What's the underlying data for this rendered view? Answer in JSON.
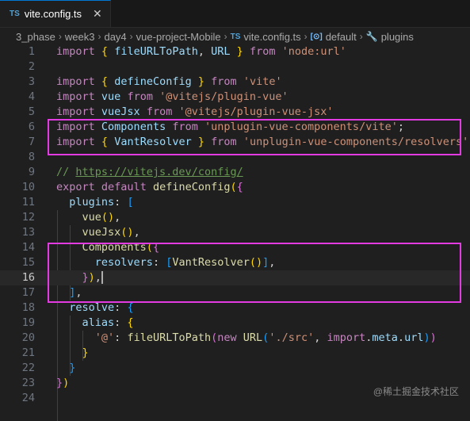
{
  "tab": {
    "badge": "TS",
    "filename": "vite.config.ts",
    "close": "✕"
  },
  "breadcrumb": [
    {
      "label": "3_phase"
    },
    {
      "label": "week3"
    },
    {
      "label": "day4"
    },
    {
      "label": "vue-project-Mobile"
    },
    {
      "icon": "TS",
      "label": "vite.config.ts"
    },
    {
      "icon": "[⊙]",
      "label": "default"
    },
    {
      "icon": "🔧",
      "label": "plugins"
    }
  ],
  "current_line": 16,
  "code_lines": [
    [
      [
        "k",
        "import"
      ],
      [
        "p",
        " "
      ],
      [
        "b1",
        "{"
      ],
      [
        "p",
        " "
      ],
      [
        "v",
        "fileURLToPath"
      ],
      [
        "p",
        ", "
      ],
      [
        "v",
        "URL"
      ],
      [
        "p",
        " "
      ],
      [
        "b1",
        "}"
      ],
      [
        "p",
        " "
      ],
      [
        "k",
        "from"
      ],
      [
        "p",
        " "
      ],
      [
        "s",
        "'node:url'"
      ]
    ],
    [],
    [
      [
        "k",
        "import"
      ],
      [
        "p",
        " "
      ],
      [
        "b1",
        "{"
      ],
      [
        "p",
        " "
      ],
      [
        "v",
        "defineConfig"
      ],
      [
        "p",
        " "
      ],
      [
        "b1",
        "}"
      ],
      [
        "p",
        " "
      ],
      [
        "k",
        "from"
      ],
      [
        "p",
        " "
      ],
      [
        "s",
        "'vite'"
      ]
    ],
    [
      [
        "k",
        "import"
      ],
      [
        "p",
        " "
      ],
      [
        "v",
        "vue"
      ],
      [
        "p",
        " "
      ],
      [
        "k",
        "from"
      ],
      [
        "p",
        " "
      ],
      [
        "s",
        "'@vitejs/plugin-vue'"
      ]
    ],
    [
      [
        "k",
        "import"
      ],
      [
        "p",
        " "
      ],
      [
        "v",
        "vueJsx"
      ],
      [
        "p",
        " "
      ],
      [
        "k",
        "from"
      ],
      [
        "p",
        " "
      ],
      [
        "s",
        "'@vitejs/plugin-vue-jsx'"
      ]
    ],
    [
      [
        "k",
        "import"
      ],
      [
        "p",
        " "
      ],
      [
        "v",
        "Components"
      ],
      [
        "p",
        " "
      ],
      [
        "k",
        "from"
      ],
      [
        "p",
        " "
      ],
      [
        "s",
        "'unplugin-vue-components/vite'"
      ],
      [
        "p",
        ";"
      ]
    ],
    [
      [
        "k",
        "import"
      ],
      [
        "p",
        " "
      ],
      [
        "b1",
        "{"
      ],
      [
        "p",
        " "
      ],
      [
        "v",
        "VantResolver"
      ],
      [
        "p",
        " "
      ],
      [
        "b1",
        "}"
      ],
      [
        "p",
        " "
      ],
      [
        "k",
        "from"
      ],
      [
        "p",
        " "
      ],
      [
        "s",
        "'unplugin-vue-components/resolvers'"
      ],
      [
        "p",
        ";"
      ]
    ],
    [],
    [
      [
        "c",
        "// "
      ],
      [
        "c url",
        "https://vitejs.dev/config/"
      ]
    ],
    [
      [
        "k",
        "export"
      ],
      [
        "p",
        " "
      ],
      [
        "k",
        "default"
      ],
      [
        "p",
        " "
      ],
      [
        "f",
        "defineConfig"
      ],
      [
        "b1",
        "("
      ],
      [
        "b2",
        "{"
      ]
    ],
    [
      [
        "p",
        "  "
      ],
      [
        "v",
        "plugins"
      ],
      [
        "p",
        ": "
      ],
      [
        "b3",
        "["
      ]
    ],
    [
      [
        "p",
        "    "
      ],
      [
        "f",
        "vue"
      ],
      [
        "b1",
        "()"
      ],
      [
        "p",
        ","
      ]
    ],
    [
      [
        "p",
        "    "
      ],
      [
        "f",
        "vueJsx"
      ],
      [
        "b1",
        "()"
      ],
      [
        "p",
        ","
      ]
    ],
    [
      [
        "p",
        "    "
      ],
      [
        "f",
        "Components"
      ],
      [
        "b1",
        "("
      ],
      [
        "b2",
        "{"
      ]
    ],
    [
      [
        "p",
        "      "
      ],
      [
        "v",
        "resolvers"
      ],
      [
        "p",
        ": "
      ],
      [
        "b3",
        "["
      ],
      [
        "f",
        "VantResolver"
      ],
      [
        "b1",
        "()"
      ],
      [
        "b3",
        "]"
      ],
      [
        "p",
        ","
      ]
    ],
    [
      [
        "p",
        "    "
      ],
      [
        "b2",
        "}"
      ],
      [
        "b1",
        ")"
      ],
      [
        "p",
        ","
      ],
      [
        "cursor",
        ""
      ]
    ],
    [
      [
        "p",
        "  "
      ],
      [
        "b3",
        "]"
      ],
      [
        "p",
        ","
      ]
    ],
    [
      [
        "p",
        "  "
      ],
      [
        "v",
        "resolve"
      ],
      [
        "p",
        ": "
      ],
      [
        "b3",
        "{"
      ]
    ],
    [
      [
        "p",
        "    "
      ],
      [
        "v",
        "alias"
      ],
      [
        "p",
        ": "
      ],
      [
        "b1",
        "{"
      ]
    ],
    [
      [
        "p",
        "      "
      ],
      [
        "s",
        "'@'"
      ],
      [
        "p",
        ": "
      ],
      [
        "f",
        "fileURLToPath"
      ],
      [
        "b2",
        "("
      ],
      [
        "k",
        "new"
      ],
      [
        "p",
        " "
      ],
      [
        "f",
        "URL"
      ],
      [
        "b3",
        "("
      ],
      [
        "s",
        "'./src'"
      ],
      [
        "p",
        ", "
      ],
      [
        "k",
        "import"
      ],
      [
        "p",
        "."
      ],
      [
        "v",
        "meta"
      ],
      [
        "p",
        "."
      ],
      [
        "v",
        "url"
      ],
      [
        "b3",
        ")"
      ],
      [
        "b2",
        ")"
      ]
    ],
    [
      [
        "p",
        "    "
      ],
      [
        "b1",
        "}"
      ]
    ],
    [
      [
        "p",
        "  "
      ],
      [
        "b3",
        "}"
      ]
    ],
    [
      [
        "b2",
        "}"
      ],
      [
        "b1",
        ")"
      ]
    ],
    []
  ],
  "watermark": "@稀土掘金技术社区"
}
